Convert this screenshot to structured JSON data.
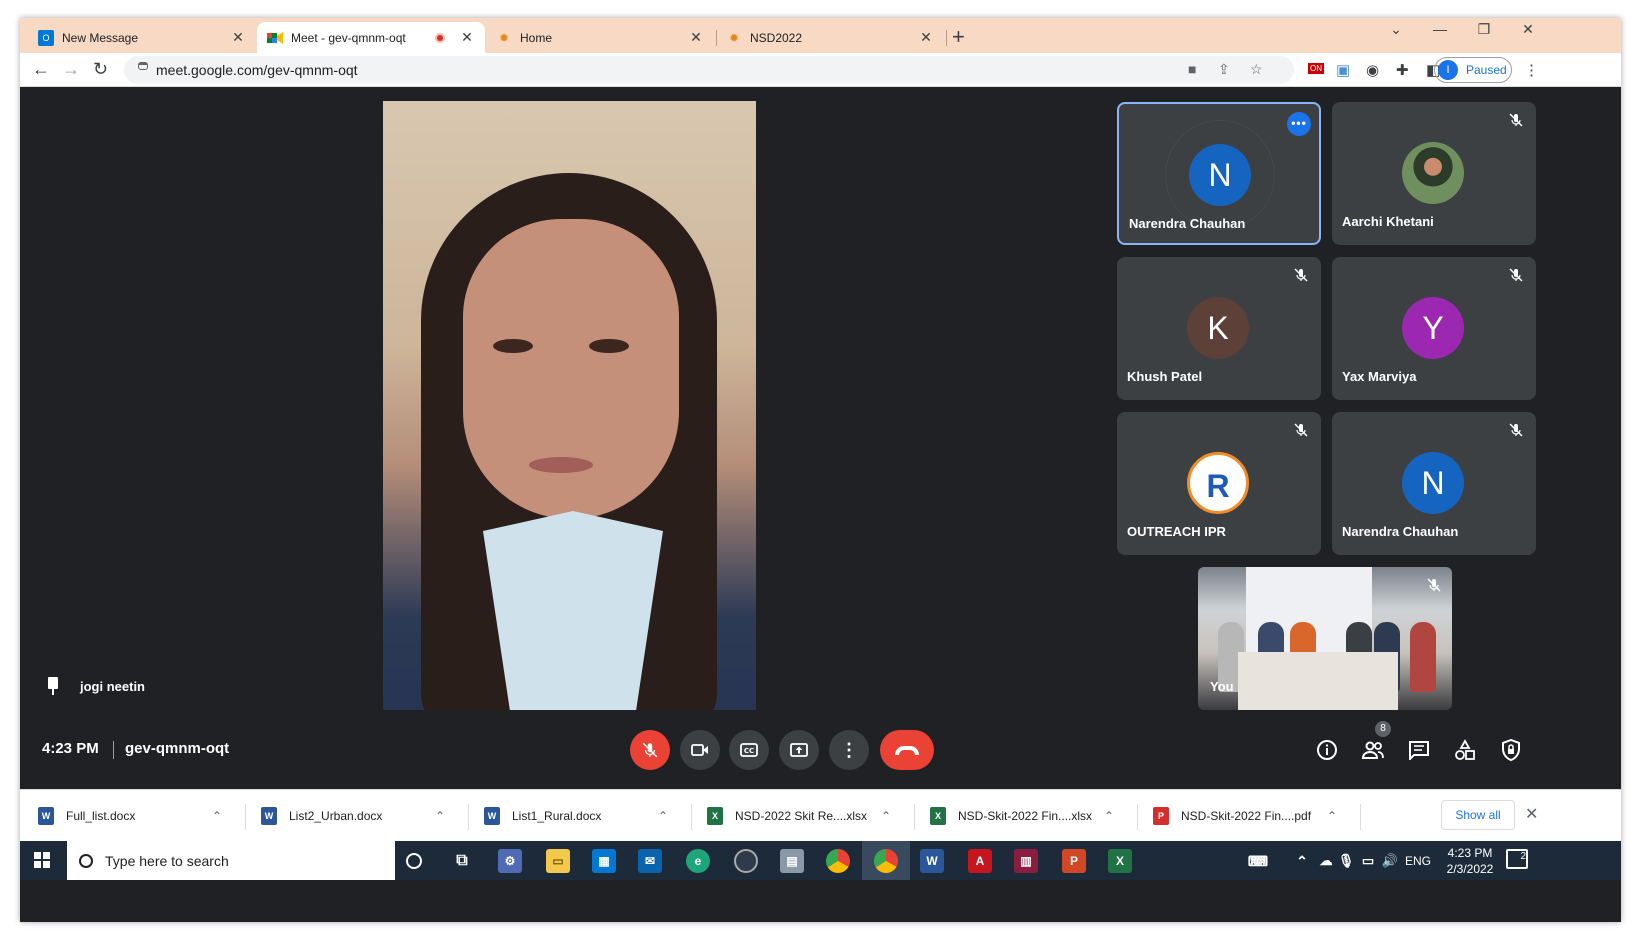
{
  "browser": {
    "tabs": [
      {
        "title": "New Message",
        "favicon": "outlook-icon",
        "active": false
      },
      {
        "title": "Meet - gev-qmnm-oqt",
        "favicon": "meet-icon",
        "active": true,
        "recording": true
      },
      {
        "title": "Home",
        "favicon": "sun-icon",
        "active": false
      },
      {
        "title": "NSD2022",
        "favicon": "sun-icon",
        "active": false
      }
    ],
    "new_tab": "+",
    "url": "meet.google.com/gev-qmnm-oqt",
    "profile_initial": "I",
    "profile_status": "Paused"
  },
  "meet": {
    "pinned_name": "jogi neetin",
    "time": "4:23 PM",
    "meeting_code": "gev-qmnm-oqt",
    "participant_count": "8",
    "tiles": [
      {
        "name": "Narendra Chauhan",
        "initial": "N",
        "color": "#1565c0",
        "active": true
      },
      {
        "name": "Aarchi Khetani",
        "initial": "",
        "color": "#4a6a4a",
        "photo": true
      },
      {
        "name": "Khush Patel",
        "initial": "K",
        "color": "#5d4037"
      },
      {
        "name": "Yax Marviya",
        "initial": "Y",
        "color": "#9c27b0"
      },
      {
        "name": "OUTREACH IPR",
        "initial": "R",
        "color": "#ffffff",
        "logo": true
      },
      {
        "name": "Narendra Chauhan",
        "initial": "N",
        "color": "#1565c0"
      }
    ],
    "self_label": "You",
    "controls": [
      "mic-off",
      "camera",
      "captions",
      "present",
      "more",
      "end-call"
    ],
    "right_controls": [
      "info",
      "people",
      "chat",
      "activities",
      "host-controls"
    ]
  },
  "downloads": {
    "items": [
      {
        "name": "Full_list.docx",
        "type": "word"
      },
      {
        "name": "List2_Urban.docx",
        "type": "word"
      },
      {
        "name": "List1_Rural.docx",
        "type": "word"
      },
      {
        "name": "NSD-2022 Skit Re....xlsx",
        "type": "excel"
      },
      {
        "name": "NSD-Skit-2022 Fin....xlsx",
        "type": "excel"
      },
      {
        "name": "NSD-Skit-2022 Fin....pdf",
        "type": "pdf"
      }
    ],
    "show_all": "Show all"
  },
  "taskbar": {
    "search_placeholder": "Type here to search",
    "language": "ENG",
    "time": "4:23 PM",
    "date": "2/3/2022",
    "notification_count": "2"
  }
}
